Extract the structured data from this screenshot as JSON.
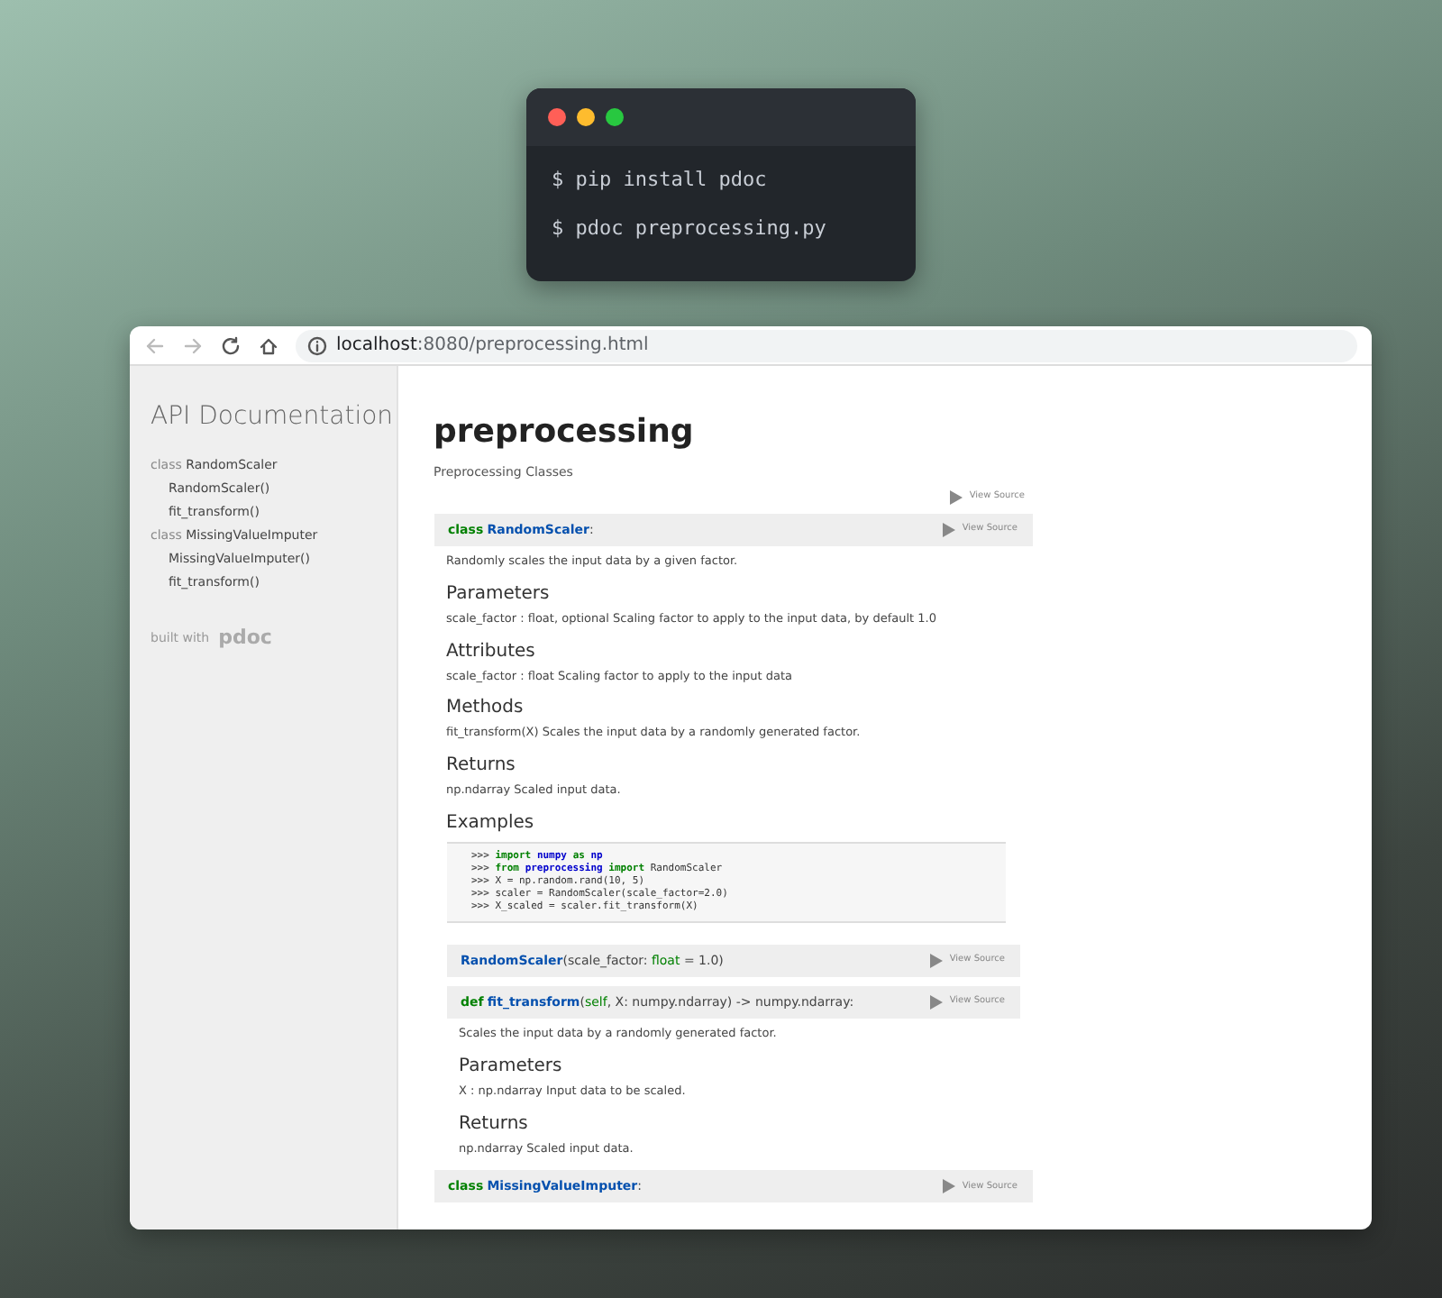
{
  "terminal": {
    "dots": [
      {
        "color": "#ff5f57"
      },
      {
        "color": "#febc2e"
      },
      {
        "color": "#28c840"
      }
    ],
    "lines": [
      "$ pip install pdoc",
      "$ pdoc preprocessing.py"
    ]
  },
  "browser": {
    "url_host": "localhost",
    "url_path": ":8080/preprocessing.html"
  },
  "sidebar": {
    "title": "API Documentation",
    "items": [
      {
        "prefix": "class",
        "name": "RandomScaler",
        "children": [
          {
            "label": "RandomScaler()"
          },
          {
            "label": "fit_transform()"
          }
        ]
      },
      {
        "prefix": "class",
        "name": "MissingValueImputer",
        "children": [
          {
            "label": "MissingValueImputer()"
          },
          {
            "label": "fit_transform()"
          }
        ]
      }
    ],
    "built_with": "built with",
    "logo": "pdoc"
  },
  "main": {
    "title": "preprocessing",
    "subtitle": "Preprocessing Classes",
    "view_source": "View Source",
    "classes": [
      {
        "signature": [
          {
            "kind": "keyword",
            "text": "class"
          },
          {
            "kind": "name",
            "text": "RandomScaler"
          },
          {
            "kind": "plain",
            "text": ":"
          }
        ],
        "view_source": "View Source",
        "blocks": [
          {
            "kind": "paragraph",
            "text": "Randomly scales the input data by a given factor."
          },
          {
            "kind": "heading",
            "text": "Parameters"
          },
          {
            "kind": "paragraph",
            "text": "scale_factor : float, optional Scaling factor to apply to the input data, by default 1.0"
          },
          {
            "kind": "heading",
            "text": "Attributes"
          },
          {
            "kind": "paragraph",
            "text": "scale_factor : float Scaling factor to apply to the input data"
          },
          {
            "kind": "heading",
            "text": "Methods"
          },
          {
            "kind": "paragraph",
            "text": "fit_transform(X) Scales the input data by a randomly generated factor."
          },
          {
            "kind": "heading",
            "text": "Returns"
          },
          {
            "kind": "paragraph",
            "text": "np.ndarray Scaled input data."
          },
          {
            "kind": "heading",
            "text": "Examples"
          },
          {
            "kind": "code",
            "lines": [
              [
                {
                  "kind": "prompt",
                  "text": ">>> "
                },
                {
                  "kind": "keyword",
                  "text": "import "
                },
                {
                  "kind": "module",
                  "text": "numpy "
                },
                {
                  "kind": "keyword",
                  "text": "as "
                },
                {
                  "kind": "module",
                  "text": "np"
                }
              ],
              [
                {
                  "kind": "prompt",
                  "text": ">>> "
                },
                {
                  "kind": "keyword",
                  "text": "from "
                },
                {
                  "kind": "module",
                  "text": "preprocessing "
                },
                {
                  "kind": "keyword",
                  "text": "import"
                },
                {
                  "kind": "plain",
                  "text": " RandomScaler"
                }
              ],
              [
                {
                  "kind": "prompt",
                  "text": ">>> "
                },
                {
                  "kind": "plain",
                  "text": "X = np.random.rand(10, 5)"
                }
              ],
              [
                {
                  "kind": "prompt",
                  "text": ">>> "
                },
                {
                  "kind": "plain",
                  "text": "scaler = RandomScaler(scale_factor=2.0)"
                }
              ],
              [
                {
                  "kind": "prompt",
                  "text": ">>> "
                },
                {
                  "kind": "plain",
                  "text": "X_scaled = scaler.fit_transform(X)"
                }
              ]
            ]
          },
          {
            "kind": "member",
            "signature": [
              {
                "kind": "name",
                "text": "RandomScaler"
              },
              {
                "kind": "plain",
                "text": "(scale_factor: "
              },
              {
                "kind": "type",
                "text": "float"
              },
              {
                "kind": "plain",
                "text": " = 1.0)"
              }
            ],
            "view_source": "View Source"
          },
          {
            "kind": "member",
            "signature": [
              {
                "kind": "keyword",
                "text": "def"
              },
              {
                "kind": "name",
                "text": "fit_transform"
              },
              {
                "kind": "plain",
                "text": "("
              },
              {
                "kind": "type",
                "text": "self"
              },
              {
                "kind": "plain",
                "text": ", X: numpy.ndarray) -> numpy.ndarray:"
              }
            ],
            "view_source": "View Source",
            "blocks": [
              {
                "kind": "paragraph",
                "text": "Scales the input data by a randomly generated factor."
              },
              {
                "kind": "heading",
                "text": "Parameters"
              },
              {
                "kind": "paragraph",
                "text": "X : np.ndarray Input data to be scaled."
              },
              {
                "kind": "heading",
                "text": "Returns"
              },
              {
                "kind": "paragraph",
                "text": "np.ndarray Scaled input data."
              }
            ]
          }
        ]
      },
      {
        "signature": [
          {
            "kind": "keyword",
            "text": "class"
          },
          {
            "kind": "name",
            "text": "MissingValueImputer"
          },
          {
            "kind": "plain",
            "text": ":"
          }
        ],
        "view_source": "View Source"
      }
    ]
  }
}
